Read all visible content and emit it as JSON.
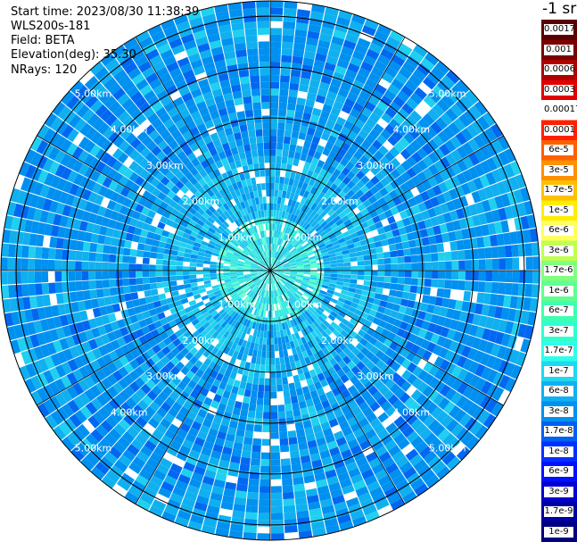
{
  "header": {
    "start_time": "Start time: 2023/08/30 11:38:39",
    "instrument": "WLS200s-181",
    "field": "Field: BETA",
    "elevation": "Elevation(deg): 35.30",
    "nrays": "NRays: 120"
  },
  "colorbar": {
    "unit_label": "-1 sr",
    "labels": [
      "0.0017",
      "0.001",
      "0.0006",
      "0.0003",
      "0.00017",
      "0.0001",
      "6e-5",
      "3e-5",
      "1.7e-5",
      "1e-5",
      "6e-6",
      "3e-6",
      "1.7e-6",
      "1e-6",
      "6e-7",
      "3e-7",
      "1.7e-7",
      "1e-7",
      "6e-8",
      "3e-8",
      "1.7e-8",
      "1e-8",
      "6e-9",
      "3e-9",
      "1.7e-9",
      "1e-9"
    ],
    "colors": [
      "#5a0000",
      "#7a0000",
      "#b00000",
      "#e00000",
      "#ffffff",
      "#ff2000",
      "#ff6000",
      "#ff9000",
      "#ffc000",
      "#ffee00",
      "#ffff60",
      "#c0ff50",
      "#80ff80",
      "#60ff90",
      "#40ffb0",
      "#30ffd0",
      "#30ffe8",
      "#20d8f0",
      "#10b0f0",
      "#0090f0",
      "#0060f0",
      "#0030ff",
      "#0010ff",
      "#0000d0",
      "#0000a0",
      "#000080"
    ]
  },
  "chart_data": {
    "type": "heatmap",
    "projection": "polar PPI",
    "rays": 120,
    "range_rings_km": [
      "1.00km",
      "2.00km",
      "3.00km",
      "4.00km",
      "5.00km"
    ],
    "radial_spokes_deg": [
      0,
      30,
      60,
      90,
      120,
      150,
      180,
      210,
      240,
      270,
      300,
      330
    ],
    "max_range_km": 5.3,
    "color_scale": "log",
    "value_range": [
      1e-09,
      0.0017
    ],
    "typical_values": {
      "center_0_1km": "3e-7",
      "mid_1_3km": "6e-8",
      "outer_3_5km": "1.7e-8"
    }
  }
}
